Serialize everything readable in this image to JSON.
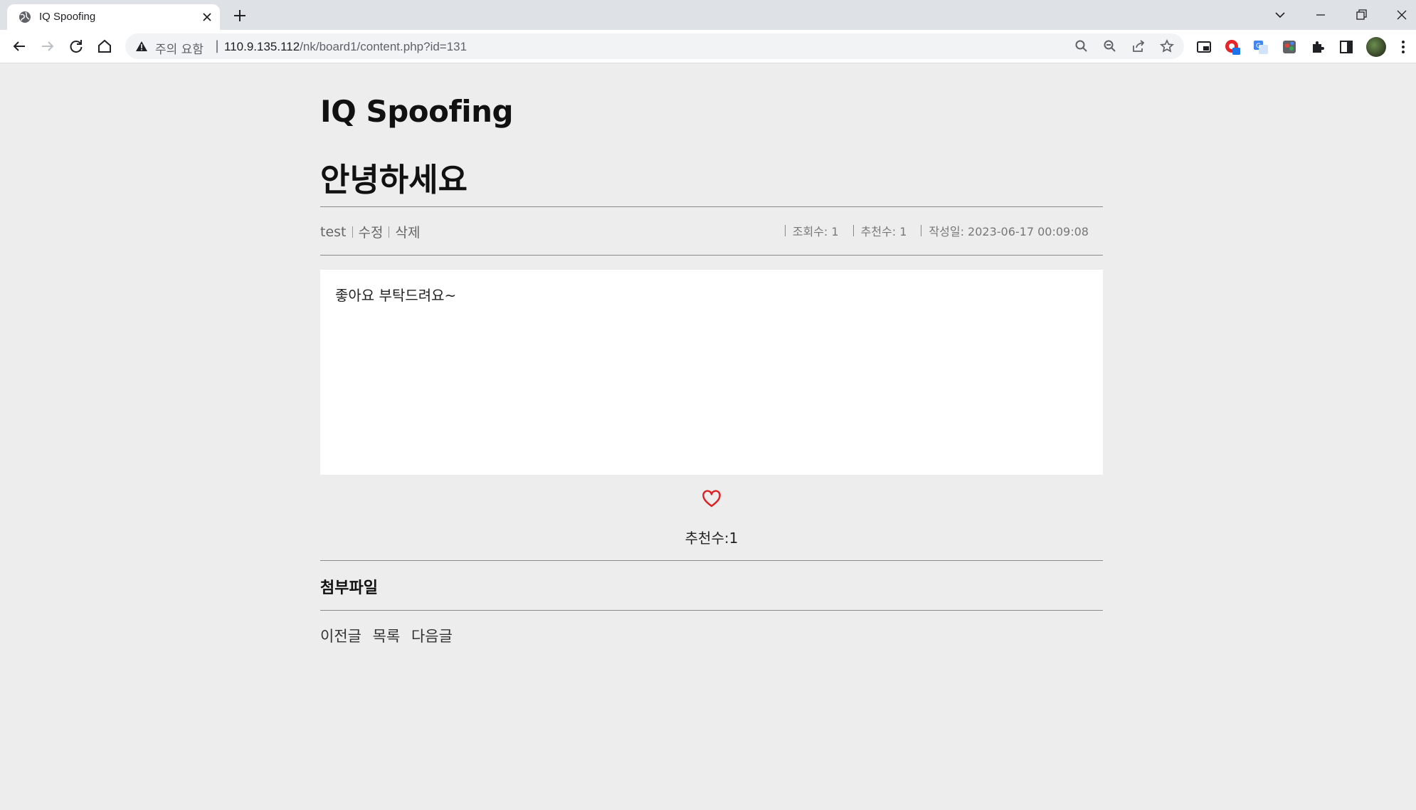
{
  "browser": {
    "tab_title": "IQ Spoofing",
    "security_label": "주의 요함",
    "url_host": "110.9.135.112",
    "url_path": "/nk/board1/content.php?id=131"
  },
  "page": {
    "site_title": "IQ Spoofing",
    "post_title": "안녕하세요",
    "author": "test",
    "edit_label": "수정",
    "delete_label": "삭제",
    "views_label": "조회수: 1",
    "recommends_label": "추천수: 1",
    "date_label": "작성일: 2023-06-17 00:09:08",
    "content": "좋아요 부탁드려요~",
    "like_count_label": "추천수:1",
    "attachment_heading": "첨부파일",
    "nav": {
      "prev": "이전글",
      "list": "목록",
      "next": "다음글"
    }
  },
  "colors": {
    "page_bg": "#ededed",
    "content_bg": "#ffffff",
    "heart": "#e02020"
  }
}
